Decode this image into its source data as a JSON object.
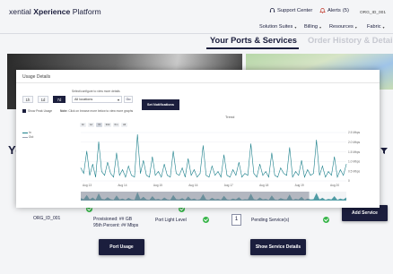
{
  "header": {
    "brand_prefix": "xential ",
    "brand_bold": "Xperience",
    "brand_suffix": " Platform",
    "support": "Support Center",
    "alerts": "Alerts",
    "alerts_count": "(5)",
    "account_id": "ORG_ID_001",
    "nav": [
      "Solution Suites",
      "Billing",
      "Resources",
      "Fabric"
    ]
  },
  "tabs": {
    "active": "Your Ports & Services",
    "inactive": "Order History & Details"
  },
  "page": {
    "heading": "Yo",
    "row": {
      "org_id": "ORG_ID_001",
      "provisioned": "Provisioned: ## GB",
      "percentile": "95th Percent: ## Mbps",
      "light_level": "Port Light Level",
      "pending_count": "1",
      "pending_label": "Pending Service(s)"
    },
    "add_service": "Add Service",
    "port_usage": "Port Usage",
    "show_details": "Show Service Details"
  },
  "modal": {
    "title": "Usage Details",
    "ranges": [
      "1h",
      "1d",
      "7d"
    ],
    "selected_range": "7d",
    "select_label": "Select/configure to view more details",
    "select_value": "All locations",
    "go": "Go",
    "notifications_button": "Set Notifications",
    "checkbox_label": "Show Peak Usage",
    "note_bold": "Note:",
    "note": "Click on browse more below to view more graphs",
    "legend_in": "In",
    "legend_out": "Out",
    "chart_title": "Trend",
    "zoom_buttons": [
      "1h",
      "1d",
      "7d",
      "30d",
      "6m",
      "All"
    ]
  },
  "chart_data": {
    "type": "line",
    "title": "Trend",
    "x_ticks": [
      "Aug 13",
      "Aug 14",
      "Aug 15",
      "Aug 16",
      "Aug 17",
      "Aug 18",
      "Aug 19",
      "Aug 20"
    ],
    "y_ticks": [
      "2.5 Mbps",
      "2.0 Mbps",
      "1.5 Mbps",
      "1.0 Mbps",
      "0.5 Mbps",
      "0"
    ],
    "ylim": [
      0,
      2.6
    ],
    "series": [
      {
        "name": "In",
        "color": "#1a7f8a",
        "values": [
          0.7,
          0.4,
          1.6,
          0.3,
          0.9,
          0.2,
          2.1,
          0.5,
          0.3,
          1.0,
          0.4,
          0.2,
          1.5,
          0.3,
          0.6,
          0.2,
          0.8,
          0.3,
          0.2,
          2.5,
          0.4,
          1.1,
          0.3,
          0.2,
          1.3,
          0.3,
          0.5,
          0.2,
          0.9,
          0.3,
          0.2,
          1.6,
          0.4,
          0.3,
          0.7,
          0.2,
          1.2,
          0.3,
          0.6,
          0.2,
          0.4,
          1.9,
          0.3,
          0.2,
          0.8,
          0.3,
          0.5,
          0.2,
          1.4,
          0.3,
          0.2,
          0.6,
          0.3,
          1.0,
          0.2,
          0.4,
          0.3,
          2.0,
          0.4,
          0.2,
          0.9,
          0.3,
          0.5,
          0.2,
          1.5,
          0.3,
          0.2,
          0.7,
          0.4,
          0.3,
          1.8,
          0.2,
          0.5,
          0.3,
          1.1,
          0.2,
          0.6,
          0.3,
          0.4,
          2.2,
          0.3,
          0.8,
          0.2,
          0.5,
          0.3,
          1.3,
          0.2,
          0.6,
          0.3,
          0.9
        ]
      }
    ]
  }
}
